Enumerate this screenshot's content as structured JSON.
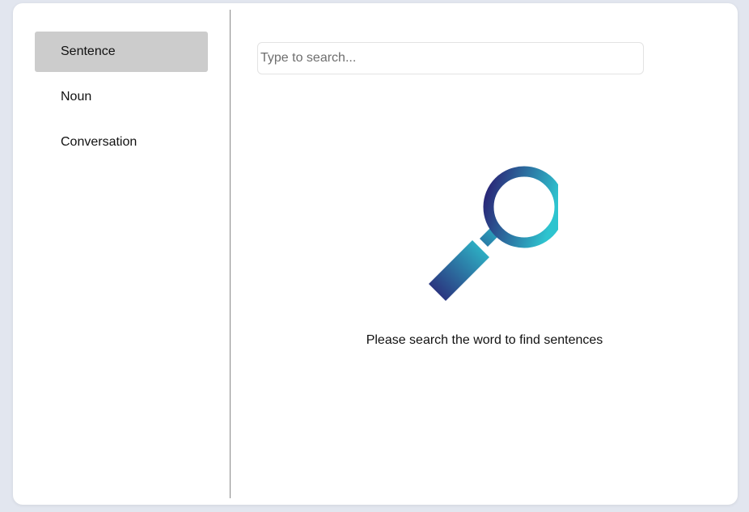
{
  "sidebar": {
    "items": [
      {
        "label": "Sentence",
        "active": true
      },
      {
        "label": "Noun",
        "active": false
      },
      {
        "label": "Conversation",
        "active": false
      }
    ]
  },
  "search": {
    "placeholder": "Type to search...",
    "value": ""
  },
  "empty_state": {
    "icon": "magnifying-glass-icon",
    "message": "Please search the word to find sentences"
  },
  "colors": {
    "active_item_bg": "#cccccc",
    "icon_gradient_start": "#2a1f73",
    "icon_gradient_end": "#2ec4cf",
    "page_bg": "#e2e6ef"
  }
}
